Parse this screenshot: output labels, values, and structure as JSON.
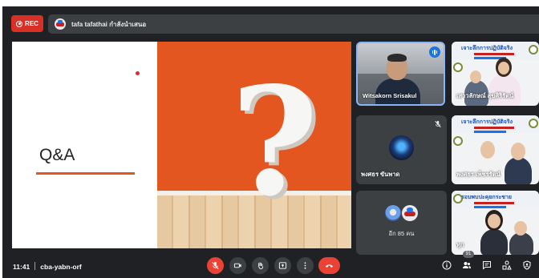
{
  "topbar": {
    "rec_label": "REC",
    "presenter_text": "tafa tafathai กำลังนำเสนอ"
  },
  "slide": {
    "title": "Q&A",
    "glyph": "?"
  },
  "participants": [
    {
      "name": "Witsakorn Srisakul",
      "speaking": true
    },
    {
      "name": "เสาวลักษณ์ สุขศิริรัตน์",
      "header": "เจาะลึกการปฏิบัติจริง"
    },
    {
      "name": "พงศธร ขันพาด",
      "muted": true
    },
    {
      "name": "พงศธร เพ็ชรรัตน์",
      "header": "เจาะลึกการปฏิบัติจริง"
    },
    {
      "name": "ทุก",
      "header": "รอบพบปะคุยกระชาย"
    }
  ],
  "others_tile": {
    "label": "อีก 85 คน"
  },
  "bottombar": {
    "time": "11:41",
    "meeting_code": "cba-yabn-orf",
    "participant_count": "91"
  },
  "icons": {
    "controls": [
      "mic-off-icon",
      "camera-icon",
      "raise-hand-icon",
      "present-icon",
      "more-options-icon",
      "hang-up-icon"
    ],
    "right": [
      "info-icon",
      "people-icon",
      "chat-icon",
      "activities-icon",
      "host-controls-icon"
    ]
  },
  "colors": {
    "accent_red": "#ea4335",
    "speaking_blue": "#1a73e8",
    "slide_orange": "#e4561f"
  }
}
